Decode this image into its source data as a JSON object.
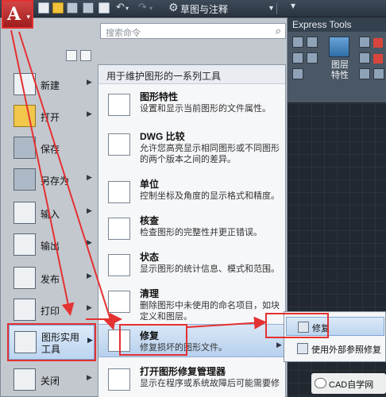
{
  "toolbar": {
    "workspace": "草图与注释",
    "icons": [
      "new-icon",
      "open-icon",
      "save-icon",
      "save-as-icon",
      "print-icon",
      "undo-icon",
      "redo-icon"
    ]
  },
  "ribbon": {
    "tab": "Express Tools",
    "panel_label": "图层\n特性"
  },
  "app_menu": {
    "search_placeholder": "搜索命令",
    "left_items": [
      {
        "label": "新建",
        "has_submenu": true
      },
      {
        "label": "打开",
        "has_submenu": true
      },
      {
        "label": "保存",
        "has_submenu": false
      },
      {
        "label": "另存为",
        "has_submenu": true
      },
      {
        "label": "输入",
        "has_submenu": true
      },
      {
        "label": "输出",
        "has_submenu": true
      },
      {
        "label": "发布",
        "has_submenu": true
      },
      {
        "label": "打印",
        "has_submenu": true
      },
      {
        "label": "图形实用\n工具",
        "has_submenu": true,
        "selected": true
      },
      {
        "label": "关闭",
        "has_submenu": true
      }
    ]
  },
  "submenu": {
    "title": "用于维护图形的一系列工具",
    "items": [
      {
        "title": "图形特性",
        "desc": "设置和显示当前图形的文件属性。"
      },
      {
        "title": "DWG 比较",
        "desc": "允许您高亮显示相同图形或不同图形的两个版本之间的差异。"
      },
      {
        "title": "单位",
        "desc": "控制坐标及角度的显示格式和精度。"
      },
      {
        "title": "核查",
        "desc": "检查图形的完整性并更正错误。"
      },
      {
        "title": "状态",
        "desc": "显示图形的统计信息、模式和范围。"
      },
      {
        "title": "清理",
        "desc": "删除图形中未使用的命名项目，如块定义和图层。"
      },
      {
        "title": "修复",
        "desc": "修复损坏的图形文件。",
        "selected": true
      },
      {
        "title": "打开图形修复管理器",
        "desc": "显示在程序或系统故障后可能需要修"
      }
    ]
  },
  "flyout": {
    "items": [
      {
        "label": "修复",
        "selected": true
      },
      {
        "label": "使用外部参照修复"
      }
    ]
  },
  "watermark": "CAD自学网",
  "colors": {
    "annotation": "#e43131",
    "accent": "#bcd5f0"
  }
}
